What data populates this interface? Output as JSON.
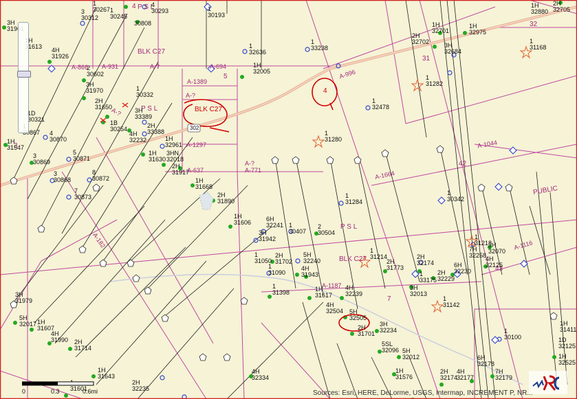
{
  "map": {
    "survey_labels": [
      "A-931",
      "A-866",
      "A-?",
      "A-694",
      "A-1389",
      "A-?",
      "A-1297",
      "A-637",
      "A-996",
      "A-1044",
      "A-1664",
      "A-1116",
      "A-1187",
      "A-?",
      "A-771",
      "A-?",
      "A-182"
    ],
    "block_labels": [
      "BLK C27",
      "BLK C27",
      "P S L",
      "P S L",
      "P S L",
      "PUBLIC"
    ],
    "section_numbers": [
      "3",
      "4",
      "5",
      "7",
      "31",
      "32",
      "42",
      "43"
    ],
    "highway_shield": "302",
    "annotations": {
      "circle_blk_c27": "BLK C27",
      "circle_4": "4"
    },
    "wells": [
      {
        "label": "1",
        "id": "30267"
      },
      {
        "label": "1",
        "id": "30245"
      },
      {
        "label": "4",
        "id": "30293"
      },
      {
        "label": "3",
        "id": "30312"
      },
      {
        "label": "",
        "id": "30808"
      },
      {
        "label": "1",
        "id": "30193"
      },
      {
        "label": "3H",
        "id": "31961"
      },
      {
        "label": "1H",
        "id": "31613"
      },
      {
        "label": "4H",
        "id": "31926"
      },
      {
        "label": "1",
        "id": "32636"
      },
      {
        "label": "1",
        "id": "33238"
      },
      {
        "label": "1H",
        "id": "32005"
      },
      {
        "label": "2",
        "id": "30602"
      },
      {
        "label": "3H",
        "id": "31970"
      },
      {
        "label": "1",
        "id": "30332"
      },
      {
        "label": "2H",
        "id": "31650"
      },
      {
        "label": "1D",
        "id": "30321"
      },
      {
        "label": "3H",
        "id": "33389"
      },
      {
        "label": "1B",
        "id": "30254"
      },
      {
        "label": "2H",
        "id": "33388"
      },
      {
        "label": "4H",
        "id": "32232"
      },
      {
        "label": "1",
        "id": "30867"
      },
      {
        "label": "4",
        "id": "30870"
      },
      {
        "label": "1H",
        "id": "31547"
      },
      {
        "label": "3",
        "id": "30869"
      },
      {
        "label": "5",
        "id": "30871"
      },
      {
        "label": "1H",
        "id": "32961"
      },
      {
        "label": "1H",
        "id": "31630"
      },
      {
        "label": "3HN",
        "id": "32018"
      },
      {
        "label": "2H",
        "id": "31917"
      },
      {
        "label": "3",
        "id": "30868"
      },
      {
        "label": "8",
        "id": "30872"
      },
      {
        "label": "7",
        "id": "30873"
      },
      {
        "label": "1H",
        "id": "31668"
      },
      {
        "label": "2H",
        "id": "31890"
      },
      {
        "label": "1",
        "id": "32478"
      },
      {
        "label": "1",
        "id": "31282"
      },
      {
        "label": "1",
        "id": "31280"
      },
      {
        "label": "1",
        "id": "31284"
      },
      {
        "label": "2H",
        "id": "32702"
      },
      {
        "label": "1H",
        "id": "32701"
      },
      {
        "label": "1H",
        "id": "32975"
      },
      {
        "label": "3H",
        "id": "32684"
      },
      {
        "label": "1",
        "id": "31168"
      },
      {
        "label": "1H",
        "id": "32880"
      },
      {
        "label": "2H",
        "id": "32705"
      },
      {
        "label": "1",
        "id": "30342"
      },
      {
        "label": "1H",
        "id": "31606"
      },
      {
        "label": "6H",
        "id": "32241"
      },
      {
        "label": "1",
        "id": "30407"
      },
      {
        "label": "2",
        "id": "30504"
      },
      {
        "label": "3H",
        "id": "31942"
      },
      {
        "label": "1",
        "id": "31214"
      },
      {
        "label": "1",
        "id": "31050"
      },
      {
        "label": "2H",
        "id": "31702"
      },
      {
        "label": "5H",
        "id": "32240"
      },
      {
        "label": "1",
        "id": "31090"
      },
      {
        "label": "4H",
        "id": "31943"
      },
      {
        "label": "2H",
        "id": "31773"
      },
      {
        "label": "2H",
        "id": "32174"
      },
      {
        "label": "1",
        "id": "33175"
      },
      {
        "label": "2H",
        "id": "32229"
      },
      {
        "label": "1",
        "id": "31218"
      },
      {
        "label": "7H",
        "id": "32258"
      },
      {
        "label": "3H",
        "id": "32070"
      },
      {
        "label": "6H",
        "id": "32230"
      },
      {
        "label": "4H",
        "id": "32125"
      },
      {
        "label": "3H",
        "id": "32013"
      },
      {
        "label": "1",
        "id": "31142"
      },
      {
        "label": "1",
        "id": "31398"
      },
      {
        "label": "1H",
        "id": "31617"
      },
      {
        "label": "4H",
        "id": "32239"
      },
      {
        "label": "4H",
        "id": "32504"
      },
      {
        "label": "5H",
        "id": "32505"
      },
      {
        "label": "3H",
        "id": "31979"
      },
      {
        "label": "5H",
        "id": "32017"
      },
      {
        "label": "1H",
        "id": "31607"
      },
      {
        "label": "4H",
        "id": "31990"
      },
      {
        "label": "2H",
        "id": "31714"
      },
      {
        "label": "2H",
        "id": "31701"
      },
      {
        "label": "3H",
        "id": "32234"
      },
      {
        "label": "5SL",
        "id": "32096"
      },
      {
        "label": "5H",
        "id": "32012"
      },
      {
        "label": "1",
        "id": "30100"
      },
      {
        "label": "1H",
        "id": "31411"
      },
      {
        "label": "1H",
        "id": "31643"
      },
      {
        "label": "4H",
        "id": "32334"
      },
      {
        "label": "1H",
        "id": "31576"
      },
      {
        "label": "6H",
        "id": "32178"
      },
      {
        "label": "2H",
        "id": "32174"
      },
      {
        "label": "4H",
        "id": "32177"
      },
      {
        "label": "7H",
        "id": "32179"
      },
      {
        "label": "1H",
        "id": "32525"
      },
      {
        "label": "2H",
        "id": "32235"
      },
      {
        "label": "1",
        "id": "31601"
      },
      {
        "label": "1D",
        "id": "32125"
      }
    ],
    "scale": {
      "ticks": [
        "0",
        "0.3",
        "0.6mi"
      ]
    },
    "attribution": "Sources: Esri, HERE, DeLorme, USGS, Intermap, INCREMENT P, NR..."
  },
  "colors": {
    "background": "#f6f3d6",
    "survey_line": "#c04aa0",
    "road": "#e8b49a",
    "annotation": "#d00000",
    "well_green": "#22aa22",
    "well_blue": "#3344cc"
  }
}
